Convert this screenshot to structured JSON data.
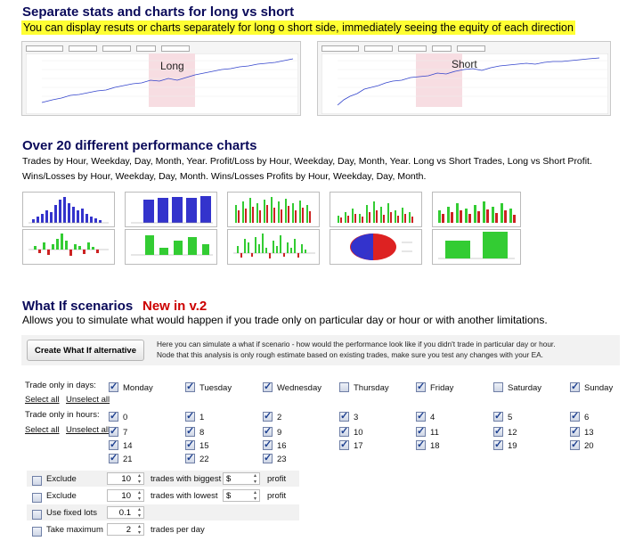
{
  "section1": {
    "title": "Separate stats and charts for long vs short",
    "subtitle": "You can display resuts or charts separately for long o short side, immediately seeing the equity of each direction",
    "long_label": "Long",
    "short_label": "Short"
  },
  "section2": {
    "title": "Over 20 different performance charts",
    "desc_line1": "Trades by Hour, Weekday, Day, Month, Year. Profit/Loss by Hour, Weekday, Day, Month, Year. Long vs Short Trades, Long vs Short Profit.",
    "desc_line2": "Wins/Losses by Hour, Weekday, Day, Month. Wins/Losses Profits by Hour, Weekday, Day, Month."
  },
  "section3": {
    "title": "What If scenarios",
    "badge": "New in v.2",
    "desc": "Allows you to simulate what would happen if you trade only on particular day or hour or with another limitations.",
    "button": "Create What If alternative",
    "info_line1": "Here you can simulate a what if scenario - how would the performance look like if you didn't trade in particular day or hour.",
    "info_line2": "Node that this analysis is only rough estimate based on existing trades, make sure you test any changes with your EA.",
    "days_label": "Trade only in days:",
    "hours_label": "Trade only in hours:",
    "select_all": "Select all",
    "unselect_all": "Unselect all",
    "days": [
      "Monday",
      "Tuesday",
      "Wednesday",
      "Thursday",
      "Friday",
      "Saturday",
      "Sunday"
    ],
    "days_checked": [
      true,
      true,
      true,
      false,
      true,
      false,
      true
    ],
    "hours_rows": [
      [
        "0",
        "1",
        "2",
        "3",
        "4",
        "5",
        "6"
      ],
      [
        "7",
        "8",
        "9",
        "10",
        "11",
        "12",
        "13"
      ],
      [
        "14",
        "15",
        "16",
        "17",
        "18",
        "19",
        "20"
      ],
      [
        "21",
        "22",
        "23"
      ]
    ],
    "options": [
      {
        "label": "Exclude",
        "value": "10",
        "middle": "trades with biggest",
        "select": "$",
        "end": "profit"
      },
      {
        "label": "Exclude",
        "value": "10",
        "middle": "trades with lowest",
        "select": "$",
        "end": "profit"
      },
      {
        "label": "Use fixed lots",
        "value": "0.1"
      },
      {
        "label": "Take maximum",
        "value": "2",
        "middle": "trades per day"
      }
    ]
  },
  "colors": {
    "accent_red": "#cc0000",
    "title_blue": "#0a0a5a",
    "highlight": "#ffff33",
    "chart_blue": "#3333cc",
    "chart_green": "#33cc33",
    "chart_red": "#cc2222"
  }
}
